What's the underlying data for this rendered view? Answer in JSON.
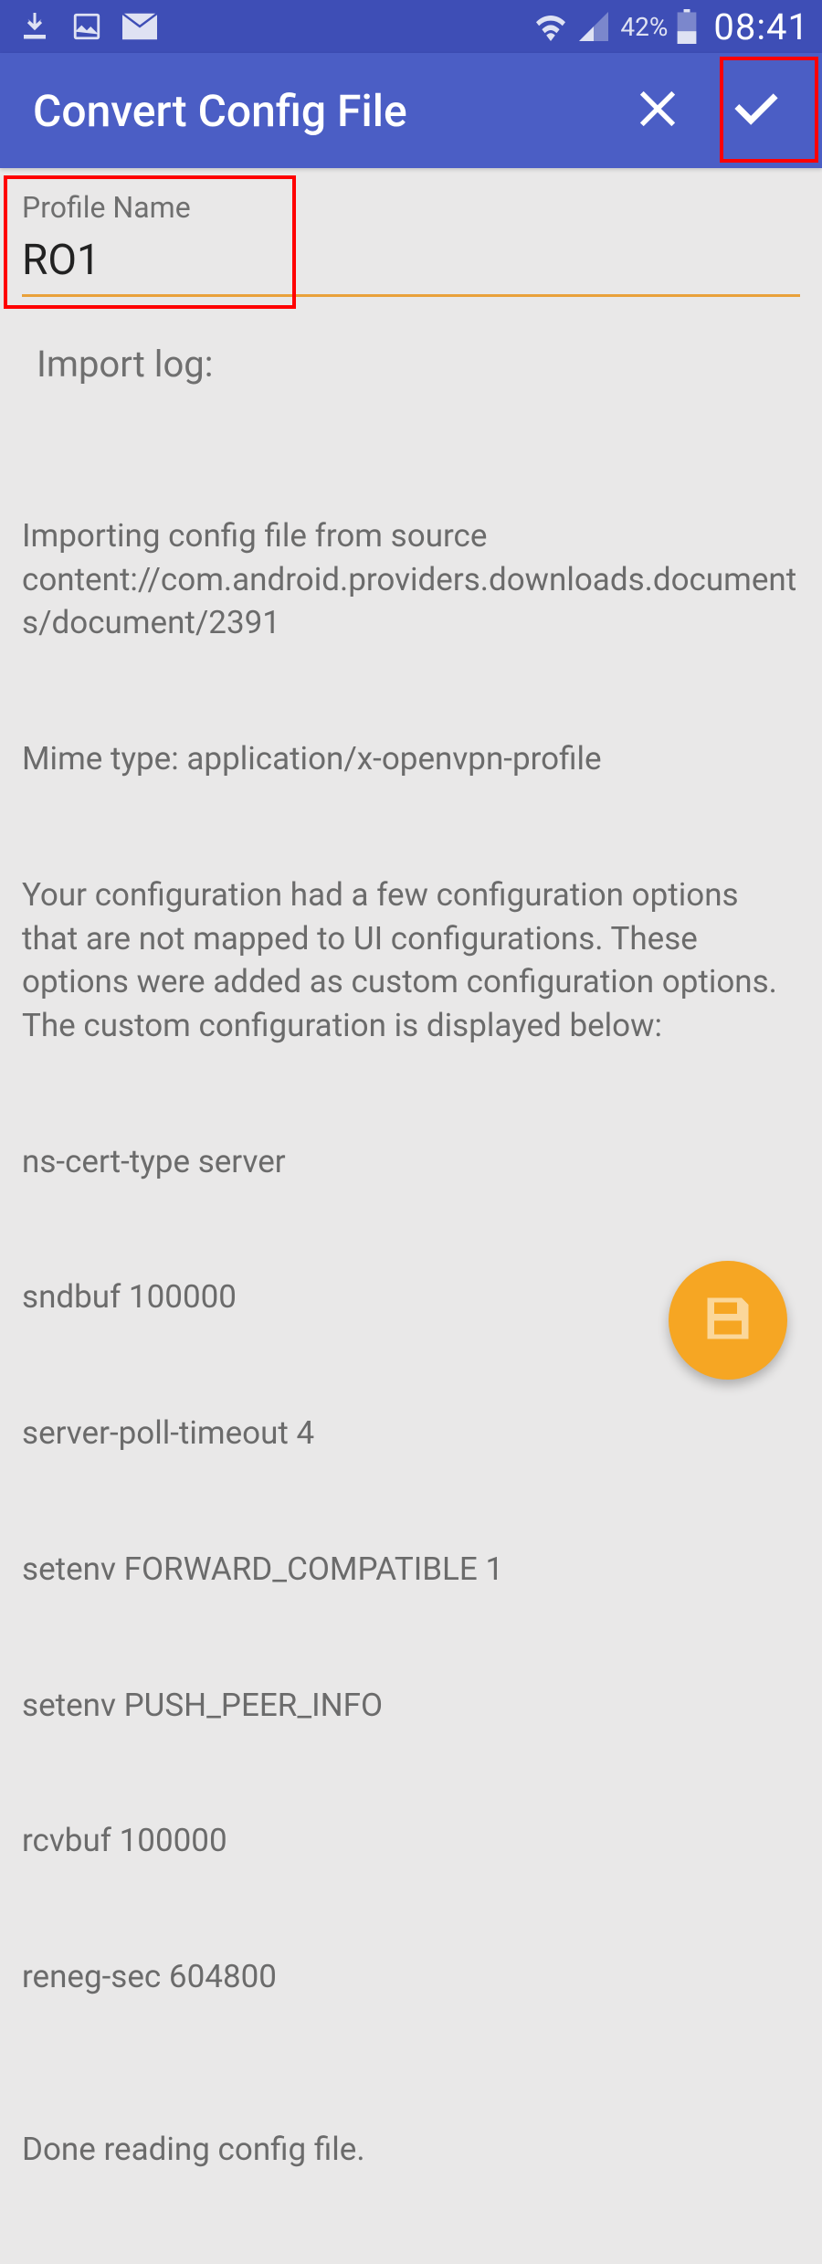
{
  "status": {
    "battery_pct": "42%",
    "time": "08:41"
  },
  "appbar": {
    "title": "Convert Config File"
  },
  "form": {
    "profile_label": "Profile Name",
    "profile_value": "RO1"
  },
  "log": {
    "heading": "Import log:",
    "line_source": "Importing config file from source content://com.android.providers.downloads.documents/document/2391",
    "line_mime": "Mime type: application/x-openvpn-profile",
    "line_note": "Your configuration had a few configuration options that are not mapped to UI configurations. These options were added as custom configuration options. The custom configuration is displayed below:",
    "line_opt1": "ns-cert-type server",
    "line_opt2": "sndbuf 100000",
    "line_opt3": "server-poll-timeout 4",
    "line_opt4": "setenv FORWARD_COMPATIBLE 1",
    "line_opt5": "setenv PUSH_PEER_INFO",
    "line_opt6": "rcvbuf 100000",
    "line_opt7": "reneg-sec 604800",
    "line_done": "Done reading config file."
  }
}
